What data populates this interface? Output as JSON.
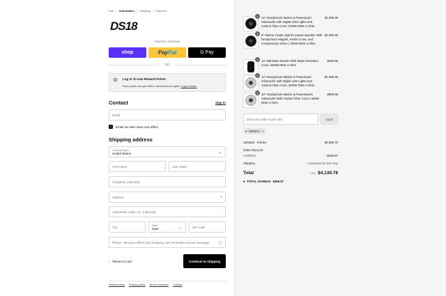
{
  "breadcrumb": [
    "Cart",
    "Information",
    "Shipping",
    "Payment"
  ],
  "breadcrumb_current": 1,
  "brand": {
    "logo_text": "DS18"
  },
  "express": {
    "label": "Express checkout",
    "shop": "shop",
    "paypal_pay": "Pay",
    "paypal_pal": "Pal",
    "gpay": "G Pay",
    "or": "OR"
  },
  "reward": {
    "title": "Log In To Use Reward Points",
    "desc": "Earn points and get offers, discounts and gifts.",
    "link": "Log in below."
  },
  "contact": {
    "heading": "Contact",
    "signin": "Sign in",
    "email_placeholder": "Email",
    "news_label": "Email me with news and offers",
    "news_checked": true
  },
  "shipping": {
    "heading": "Shipping address",
    "country_label": "Country/Region",
    "country_value": "United States",
    "first_name": "First name",
    "last_name": "Last name",
    "company": "Company (optional)",
    "address": "Address",
    "apartment": "Apartment, suite, etc. (optional)",
    "city": "City",
    "state_label": "State",
    "state_value": "Iowa",
    "zip": "ZIP code",
    "phone": "Phone - Receive offers and shopping cart reminders via text message"
  },
  "actions": {
    "return": "Return to cart",
    "continue": "Continue to shipping"
  },
  "policies": [
    "Refund policy",
    "Privacy policy",
    "Terms of service",
    "Cookies"
  ],
  "items": [
    {
      "qty": "1",
      "name": "12\" Neodymium Marine & Powersport Subwoofer with Digital LED Lights and Carbon Fiber Cone | 800W RMS 4-Ohm",
      "price": "$1,099.95"
    },
    {
      "qty": "1",
      "name": "8\" Marine Grade Hybrid Coaxial Speaker With Neodymium Magnet, Kevlar Cone, and Compression Driver | 200W RMS 4-Ohm",
      "price": "$1,099.95"
    },
    {
      "qty": "1",
      "name": "10\" Mid-Bass Woofer With Water Resistant Cone | 500W RMS 4-Ohm",
      "price": "$299.95"
    },
    {
      "qty": "1",
      "name": "12\" Neodymium Marine & Powersport Subwoofer with Digital LED Lights and Carbon Fiber Cone | 800W RMS 4-Ohm",
      "price": "$1,099.95"
    },
    {
      "qty": "1",
      "name": "10\" Neodymium Marine & Powersports Subwoofer With Carbon Fiber Cone | 600W RMS 4-Ohm",
      "price": "$999.95"
    }
  ],
  "discount": {
    "placeholder": "Discount code or gift card",
    "apply": "Apply",
    "tag": "ERMAC"
  },
  "summary": {
    "subtotal_label": "Subtotal · 5 items",
    "subtotal": "$4,599.75",
    "order_discount_label": "Order discount",
    "code": "ERMAC",
    "discount": "- $459.97",
    "shipping_label": "Shipping",
    "shipping": "Calculated at next step",
    "total_label": "Total",
    "currency": "USD",
    "total": "$4,139.78",
    "savings_label": "TOTAL SAVINGS",
    "savings": "$459.97"
  }
}
